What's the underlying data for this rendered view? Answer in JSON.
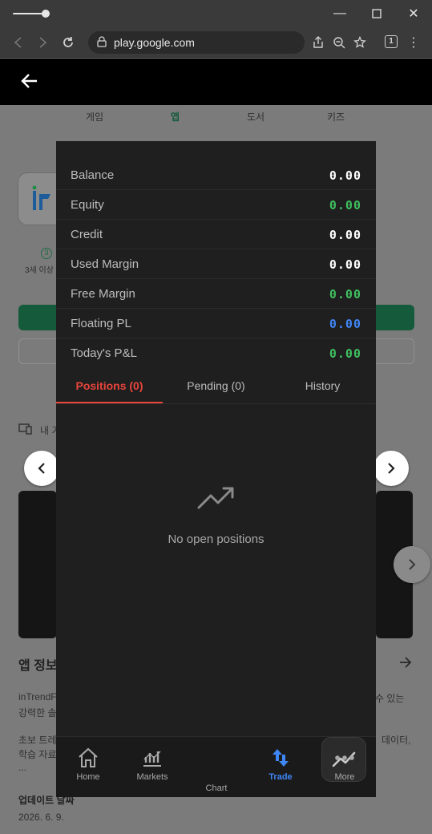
{
  "browser": {
    "url": "play.google.com",
    "tab_count": "1"
  },
  "page_under": {
    "tabs": [
      "게임",
      "앱",
      "도서",
      "키즈"
    ],
    "age_rating": "3세 이상",
    "section_devices": "내 기",
    "section_app_info": "앱 정보",
    "desc_1": "inTrendF",
    "desc_1b": "수 있는",
    "desc_2": "강력한 솔",
    "desc_3": "초보 트레",
    "desc_3b": "데이터,",
    "desc_4": "학습 자료",
    "desc_5": "...",
    "update_label": "업데이트 날짜",
    "update_date": "2026. 6. 9."
  },
  "account": {
    "rows": [
      {
        "label": "Balance",
        "value": "0.00",
        "color": "#ffffff"
      },
      {
        "label": "Equity",
        "value": "0.00",
        "color": "#3fbf5f"
      },
      {
        "label": "Credit",
        "value": "0.00",
        "color": "#ffffff"
      },
      {
        "label": "Used Margin",
        "value": "0.00",
        "color": "#ffffff"
      },
      {
        "label": "Free Margin",
        "value": "0.00",
        "color": "#3fbf5f"
      },
      {
        "label": "Floating PL",
        "value": "0.00",
        "color": "#3f86f5"
      },
      {
        "label": "Today's P&L",
        "value": "0.00",
        "color": "#3fbf5f"
      }
    ]
  },
  "positions_tabs": {
    "positions": "Positions (0)",
    "pending": "Pending (0)",
    "history": "History"
  },
  "empty_state": "No open positions",
  "bottom_nav": {
    "home": "Home",
    "markets": "Markets",
    "chart": "Chart",
    "trade": "Trade",
    "more": "More",
    "active_color": "#3f86f5"
  }
}
